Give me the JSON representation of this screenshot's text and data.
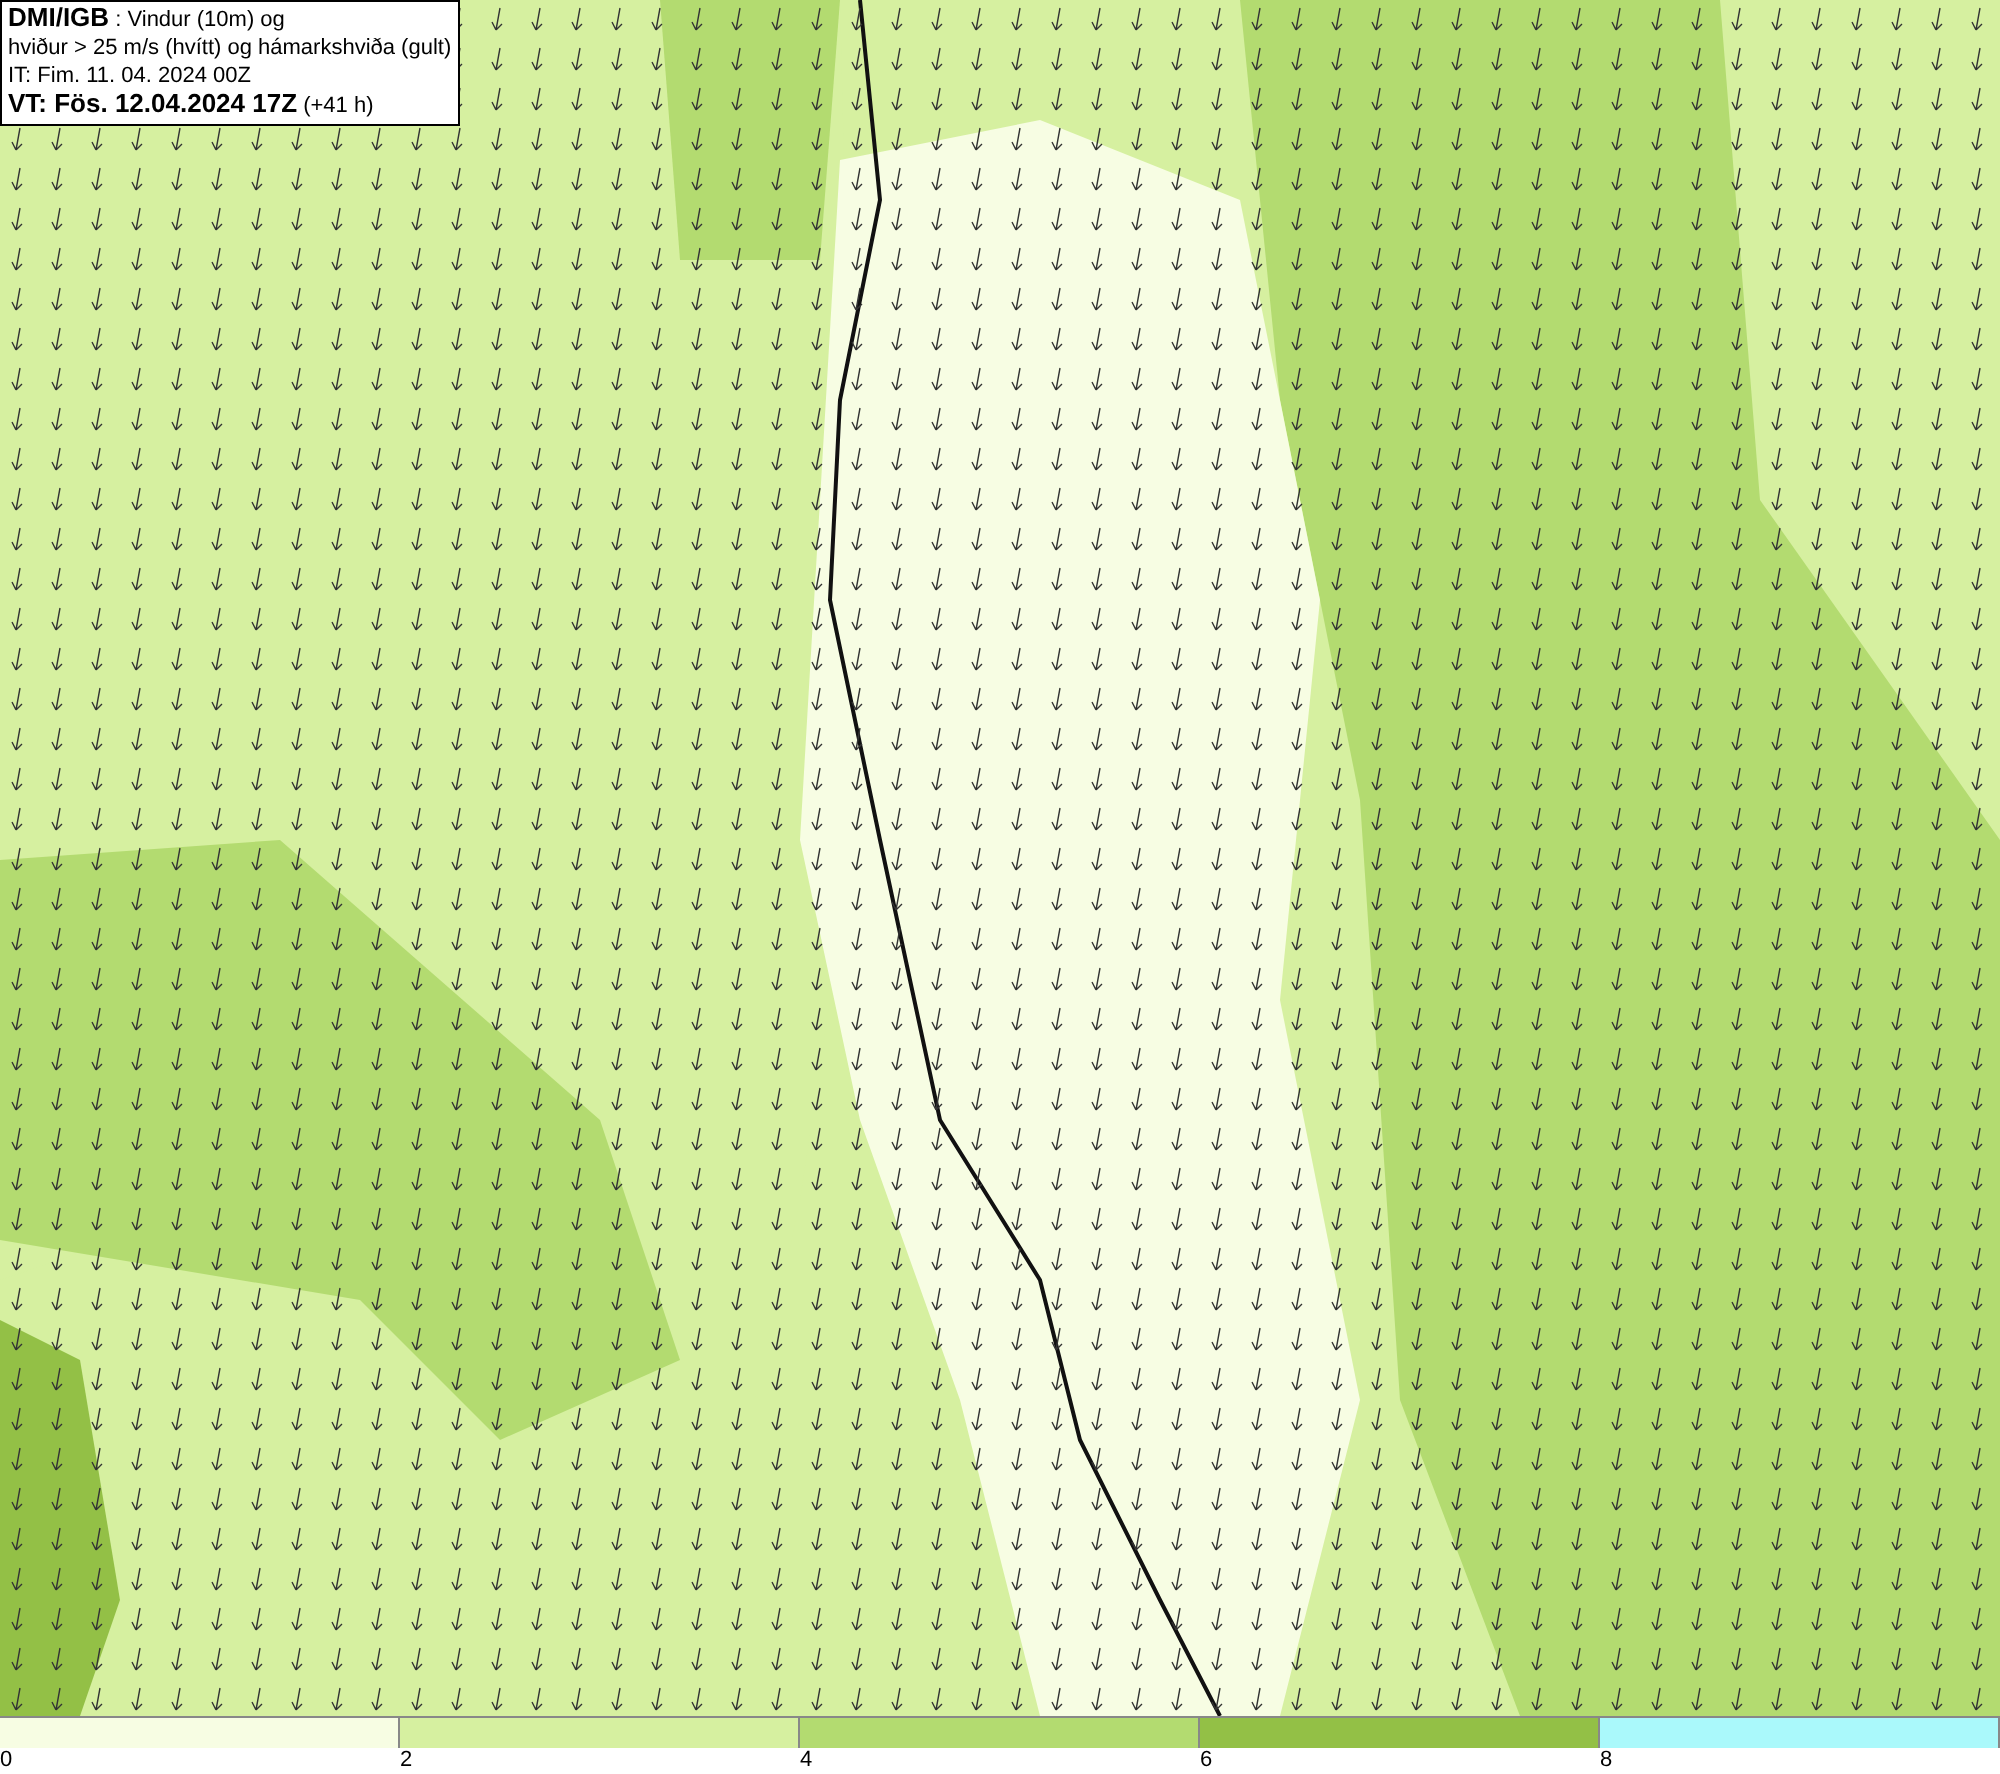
{
  "header": {
    "lines": [
      "**DMI/IGB** : Vindur (10m) og",
      "hviður > 25 m/s (hvítt) og hámarkshviða (gult)",
      "IT: Fim. 11. 04. 2024 00Z",
      "**VT: Fös. 12.04.2024 17Z** (+41 h)"
    ]
  },
  "legend": [
    {
      "label": "0",
      "color": "#f7fde3"
    },
    {
      "label": "2",
      "color": "#d6f0a0"
    },
    {
      "label": "4",
      "color": "#b3db70"
    },
    {
      "label": "6",
      "color": "#93c046"
    },
    {
      "label": "8",
      "color": "#aaf9fb"
    }
  ]
}
